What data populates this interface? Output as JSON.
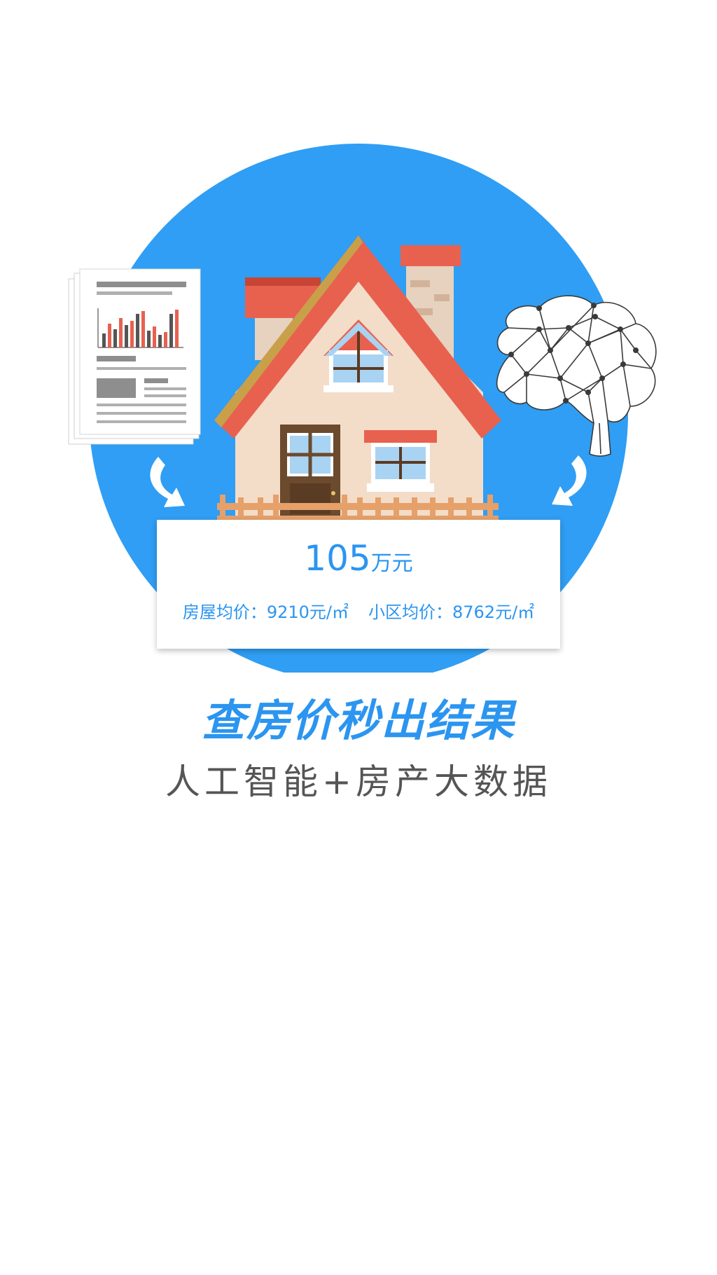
{
  "card": {
    "price_value": "105",
    "price_unit": "万元",
    "house_label": "房屋均价：",
    "house_value": "9210元/㎡",
    "community_label": "小区均价：",
    "community_value": "8762元/㎡"
  },
  "headline": "查房价秒出结果",
  "subline": "人工智能+房产大数据",
  "colors": {
    "accent": "#2b95f0",
    "circle": "#2f9ef4",
    "roof": "#e8614f",
    "wall": "#f3ddc9",
    "subtext": "#555555"
  },
  "icons": [
    "report-document-icon",
    "house-icon",
    "brain-network-icon",
    "curved-arrow-icon"
  ]
}
